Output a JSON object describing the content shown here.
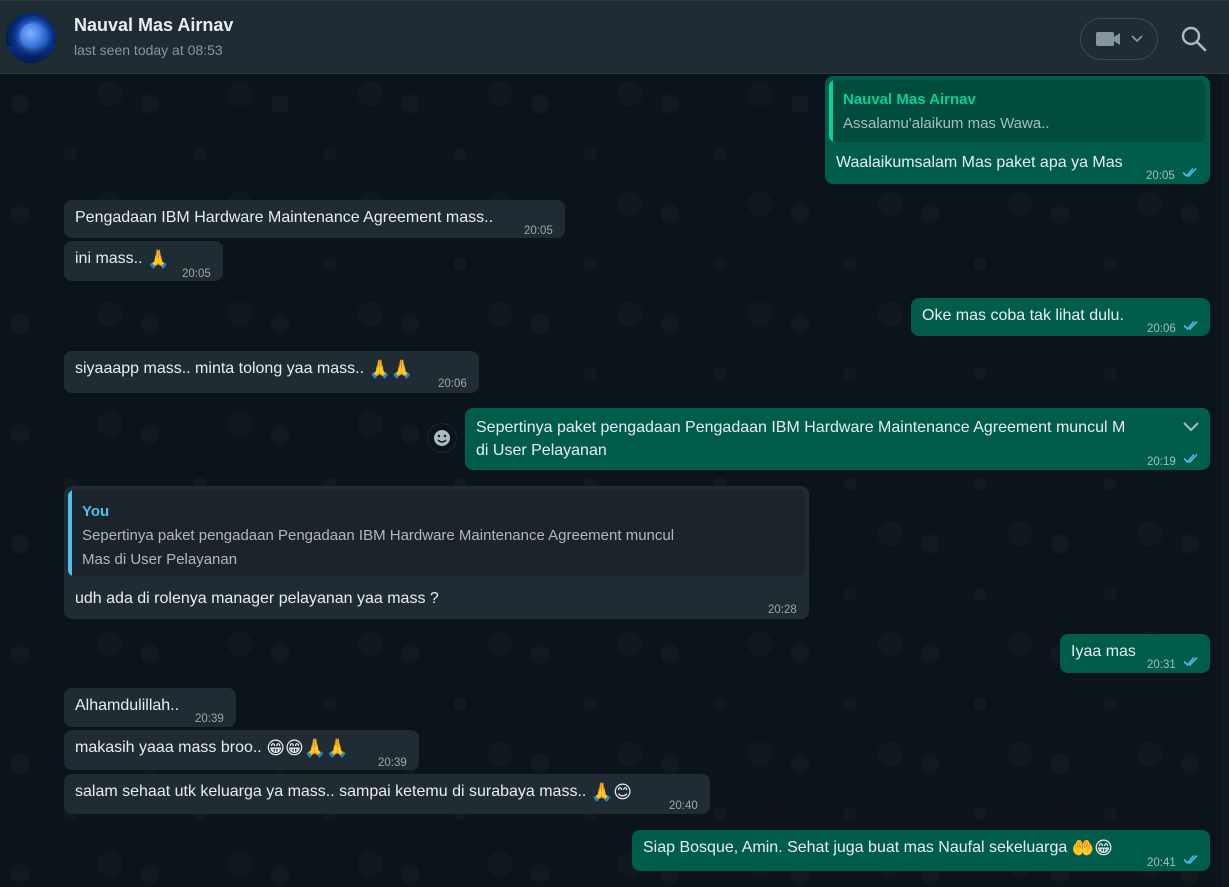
{
  "header": {
    "contact_name": "Nauval Mas Airnav",
    "status": "last seen today at 08:53",
    "icons": {
      "avatar": "contact-avatar",
      "call": "video-call-icon",
      "dropdown": "chevron-down-icon",
      "search": "search-icon"
    }
  },
  "colors": {
    "incoming": "#202c33",
    "outgoing": "#005c4b",
    "read_ticks": "#53bdeb",
    "quote_author_contact": "#06cf9c",
    "quote_author_you": "#53bdeb"
  },
  "messages": [
    {
      "direction": "out",
      "reply_to": {
        "author": "Nauval Mas Airnav",
        "text": "Assalamu'alaikum mas Wawa.."
      },
      "text": "Waalaikumsalam Mas paket apa ya Mas",
      "time": "20:05",
      "status": "read"
    },
    {
      "direction": "in",
      "text": "Pengadaan IBM Hardware Maintenance Agreement mass..",
      "time": "20:05"
    },
    {
      "direction": "in",
      "text": "ini mass..",
      "emoji": "🙏",
      "time": "20:05"
    },
    {
      "direction": "out",
      "text": "Oke mas coba tak lihat dulu.",
      "time": "20:06",
      "status": "read"
    },
    {
      "direction": "in",
      "text": "siyaaapp mass.. minta tolong yaa mass..",
      "emoji": "🙏🙏",
      "time": "20:06"
    },
    {
      "direction": "out",
      "text_line1": "Sepertinya paket pengadaan Pengadaan IBM Hardware Maintenance Agreement muncul M",
      "text_line2": "di User Pelayanan",
      "time": "20:19",
      "status": "read"
    },
    {
      "direction": "in",
      "reply_to": {
        "author": "You",
        "text_line1": "Sepertinya paket pengadaan Pengadaan IBM Hardware Maintenance Agreement muncul",
        "text_line2": "Mas di User Pelayanan"
      },
      "text": "udh ada di rolenya manager pelayanan yaa mass ?",
      "time": "20:28"
    },
    {
      "direction": "out",
      "text": "Iyaa mas",
      "time": "20:31",
      "status": "read"
    },
    {
      "direction": "in",
      "text": "Alhamdulillah..",
      "time": "20:39"
    },
    {
      "direction": "in",
      "text": "makasih yaaa mass broo..",
      "emoji": "😁😁🙏🙏",
      "time": "20:39"
    },
    {
      "direction": "in",
      "text": "salam sehaat utk keluarga ya mass.. sampai ketemu di surabaya mass..",
      "emoji": "🙏😊",
      "time": "20:40"
    },
    {
      "direction": "out",
      "text": "Siap Bosque, Amin. Sehat juga buat mas Naufal sekeluarga",
      "emoji": "🤲😁",
      "time": "20:41",
      "status": "read"
    }
  ]
}
